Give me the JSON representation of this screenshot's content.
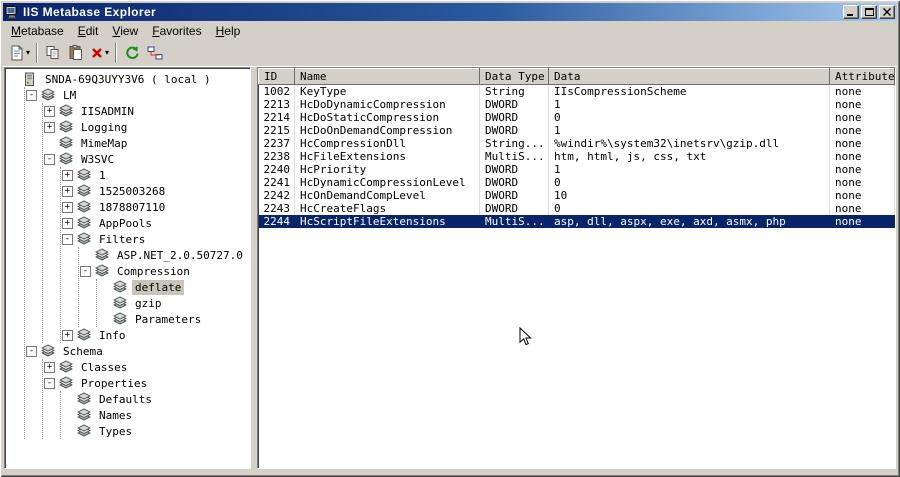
{
  "window": {
    "title": "IIS Metabase Explorer",
    "controls": [
      {
        "name": "minimize-button"
      },
      {
        "name": "maximize-button"
      },
      {
        "name": "close-button"
      }
    ]
  },
  "colors": {
    "titlebar_start": "#0a246a",
    "titlebar_end": "#a6caf0",
    "selection": "#0a246a",
    "window_face": "#d4d0c8",
    "tree_inactive_selection": "#c8c4b8"
  },
  "menu": {
    "items": [
      {
        "label": "Metabase"
      },
      {
        "label": "Edit"
      },
      {
        "label": "View"
      },
      {
        "label": "Favorites"
      },
      {
        "label": "Help"
      }
    ]
  },
  "toolbar": {
    "buttons": [
      {
        "name": "new-key-button",
        "icon": "new-key-icon",
        "dropdown": true
      },
      {
        "type": "separator"
      },
      {
        "name": "copy-button",
        "icon": "copy-icon"
      },
      {
        "name": "paste-button",
        "icon": "paste-icon"
      },
      {
        "name": "delete-button",
        "icon": "delete-icon",
        "dropdown": true
      },
      {
        "type": "separator"
      },
      {
        "name": "refresh-button",
        "icon": "refresh-icon"
      },
      {
        "name": "connect-computer-button",
        "icon": "connect-icon"
      }
    ]
  },
  "tree": {
    "nodes": [
      {
        "label": "SNDA-69Q3UYY3V6 ( local )",
        "icon": "server",
        "children": [
          {
            "label": "LM",
            "icon": "key",
            "expand": "minus",
            "children": [
              {
                "label": "IISADMIN",
                "icon": "key",
                "expand": "plus"
              },
              {
                "label": "Logging",
                "icon": "key",
                "expand": "plus"
              },
              {
                "label": "MimeMap",
                "icon": "key"
              },
              {
                "label": "W3SVC",
                "icon": "key",
                "expand": "minus",
                "children": [
                  {
                    "label": "1",
                    "icon": "key",
                    "expand": "plus"
                  },
                  {
                    "label": "1525003268",
                    "icon": "key",
                    "expand": "plus"
                  },
                  {
                    "label": "1878807110",
                    "icon": "key",
                    "expand": "plus"
                  },
                  {
                    "label": "AppPools",
                    "icon": "key",
                    "expand": "plus"
                  },
                  {
                    "label": "Filters",
                    "icon": "key",
                    "expand": "minus",
                    "children": [
                      {
                        "label": "ASP.NET_2.0.50727.0",
                        "icon": "key"
                      },
                      {
                        "label": "Compression",
                        "icon": "key",
                        "expand": "minus",
                        "children": [
                          {
                            "label": "deflate",
                            "icon": "key",
                            "selected": true
                          },
                          {
                            "label": "gzip",
                            "icon": "key"
                          },
                          {
                            "label": "Parameters",
                            "icon": "key"
                          }
                        ]
                      }
                    ]
                  },
                  {
                    "label": "Info",
                    "icon": "key",
                    "expand": "plus"
                  }
                ]
              }
            ]
          },
          {
            "label": "Schema",
            "icon": "key",
            "expand": "minus",
            "children": [
              {
                "label": "Classes",
                "icon": "key",
                "expand": "plus"
              },
              {
                "label": "Properties",
                "icon": "key",
                "expand": "minus",
                "children": [
                  {
                    "label": "Defaults",
                    "icon": "key"
                  },
                  {
                    "label": "Names",
                    "icon": "key"
                  },
                  {
                    "label": "Types",
                    "icon": "key"
                  }
                ]
              }
            ]
          }
        ]
      }
    ]
  },
  "table": {
    "columns": [
      {
        "key": "id",
        "label": "ID"
      },
      {
        "key": "name",
        "label": "Name"
      },
      {
        "key": "type",
        "label": "Data Type"
      },
      {
        "key": "data",
        "label": "Data"
      },
      {
        "key": "attrs",
        "label": "Attributes"
      }
    ],
    "rows": [
      {
        "id": "1002",
        "name": "KeyType",
        "type": "String",
        "data": "IIsCompressionScheme",
        "attrs": "none"
      },
      {
        "id": "2213",
        "name": "HcDoDynamicCompression",
        "type": "DWORD",
        "data": "1",
        "attrs": "none"
      },
      {
        "id": "2214",
        "name": "HcDoStaticCompression",
        "type": "DWORD",
        "data": "0",
        "attrs": "none"
      },
      {
        "id": "2215",
        "name": "HcDoOnDemandCompression",
        "type": "DWORD",
        "data": "1",
        "attrs": "none"
      },
      {
        "id": "2237",
        "name": "HcCompressionDll",
        "type": "String...",
        "data": "%windir%\\system32\\inetsrv\\gzip.dll",
        "attrs": "none"
      },
      {
        "id": "2238",
        "name": "HcFileExtensions",
        "type": "MultiS...",
        "data": "htm, html, js, css, txt",
        "attrs": "none"
      },
      {
        "id": "2240",
        "name": "HcPriority",
        "type": "DWORD",
        "data": "1",
        "attrs": "none"
      },
      {
        "id": "2241",
        "name": "HcDynamicCompressionLevel",
        "type": "DWORD",
        "data": "0",
        "attrs": "none"
      },
      {
        "id": "2242",
        "name": "HcOnDemandCompLevel",
        "type": "DWORD",
        "data": "10",
        "attrs": "none"
      },
      {
        "id": "2243",
        "name": "HcCreateFlags",
        "type": "DWORD",
        "data": "0",
        "attrs": "none"
      },
      {
        "id": "2244",
        "name": "HcScriptFileExtensions",
        "type": "MultiS...",
        "data": "asp, dll, aspx, exe, axd, asmx, php",
        "attrs": "none",
        "selected": true
      }
    ]
  }
}
